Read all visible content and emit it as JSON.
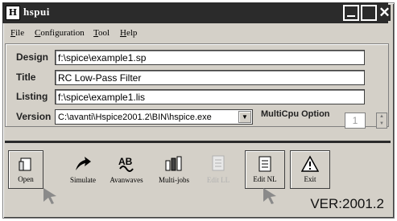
{
  "window": {
    "title": "hspui",
    "app_icon_glyph": "H"
  },
  "menu": [
    "File",
    "Configuration",
    "Tool",
    "Help"
  ],
  "fields": {
    "design": {
      "label": "Design",
      "value": "f:\\spice\\example1.sp"
    },
    "title": {
      "label": "Title",
      "value": "RC Low-Pass Filter"
    },
    "listing": {
      "label": "Listing",
      "value": "f:\\spice\\example1.lis"
    },
    "version": {
      "label": "Version",
      "value": "C:\\avanti\\Hspice2001.2\\BIN\\hspice.exe"
    }
  },
  "multicpu": {
    "label": "MultiCpu Option",
    "value": "1"
  },
  "toolbar": {
    "open": "Open",
    "simulate": "Simulate",
    "avanwaves": "Avanwaves",
    "multijobs": "Multi-jobs",
    "edit_ll": "Edit LL",
    "edit_nl": "Edit NL",
    "exit": "Exit"
  },
  "status": {
    "version": "VER:2001.2"
  },
  "colors": {
    "titlebar": "#2b2b2b",
    "face": "#d4d0c8",
    "disabled": "#b0b0b0"
  }
}
